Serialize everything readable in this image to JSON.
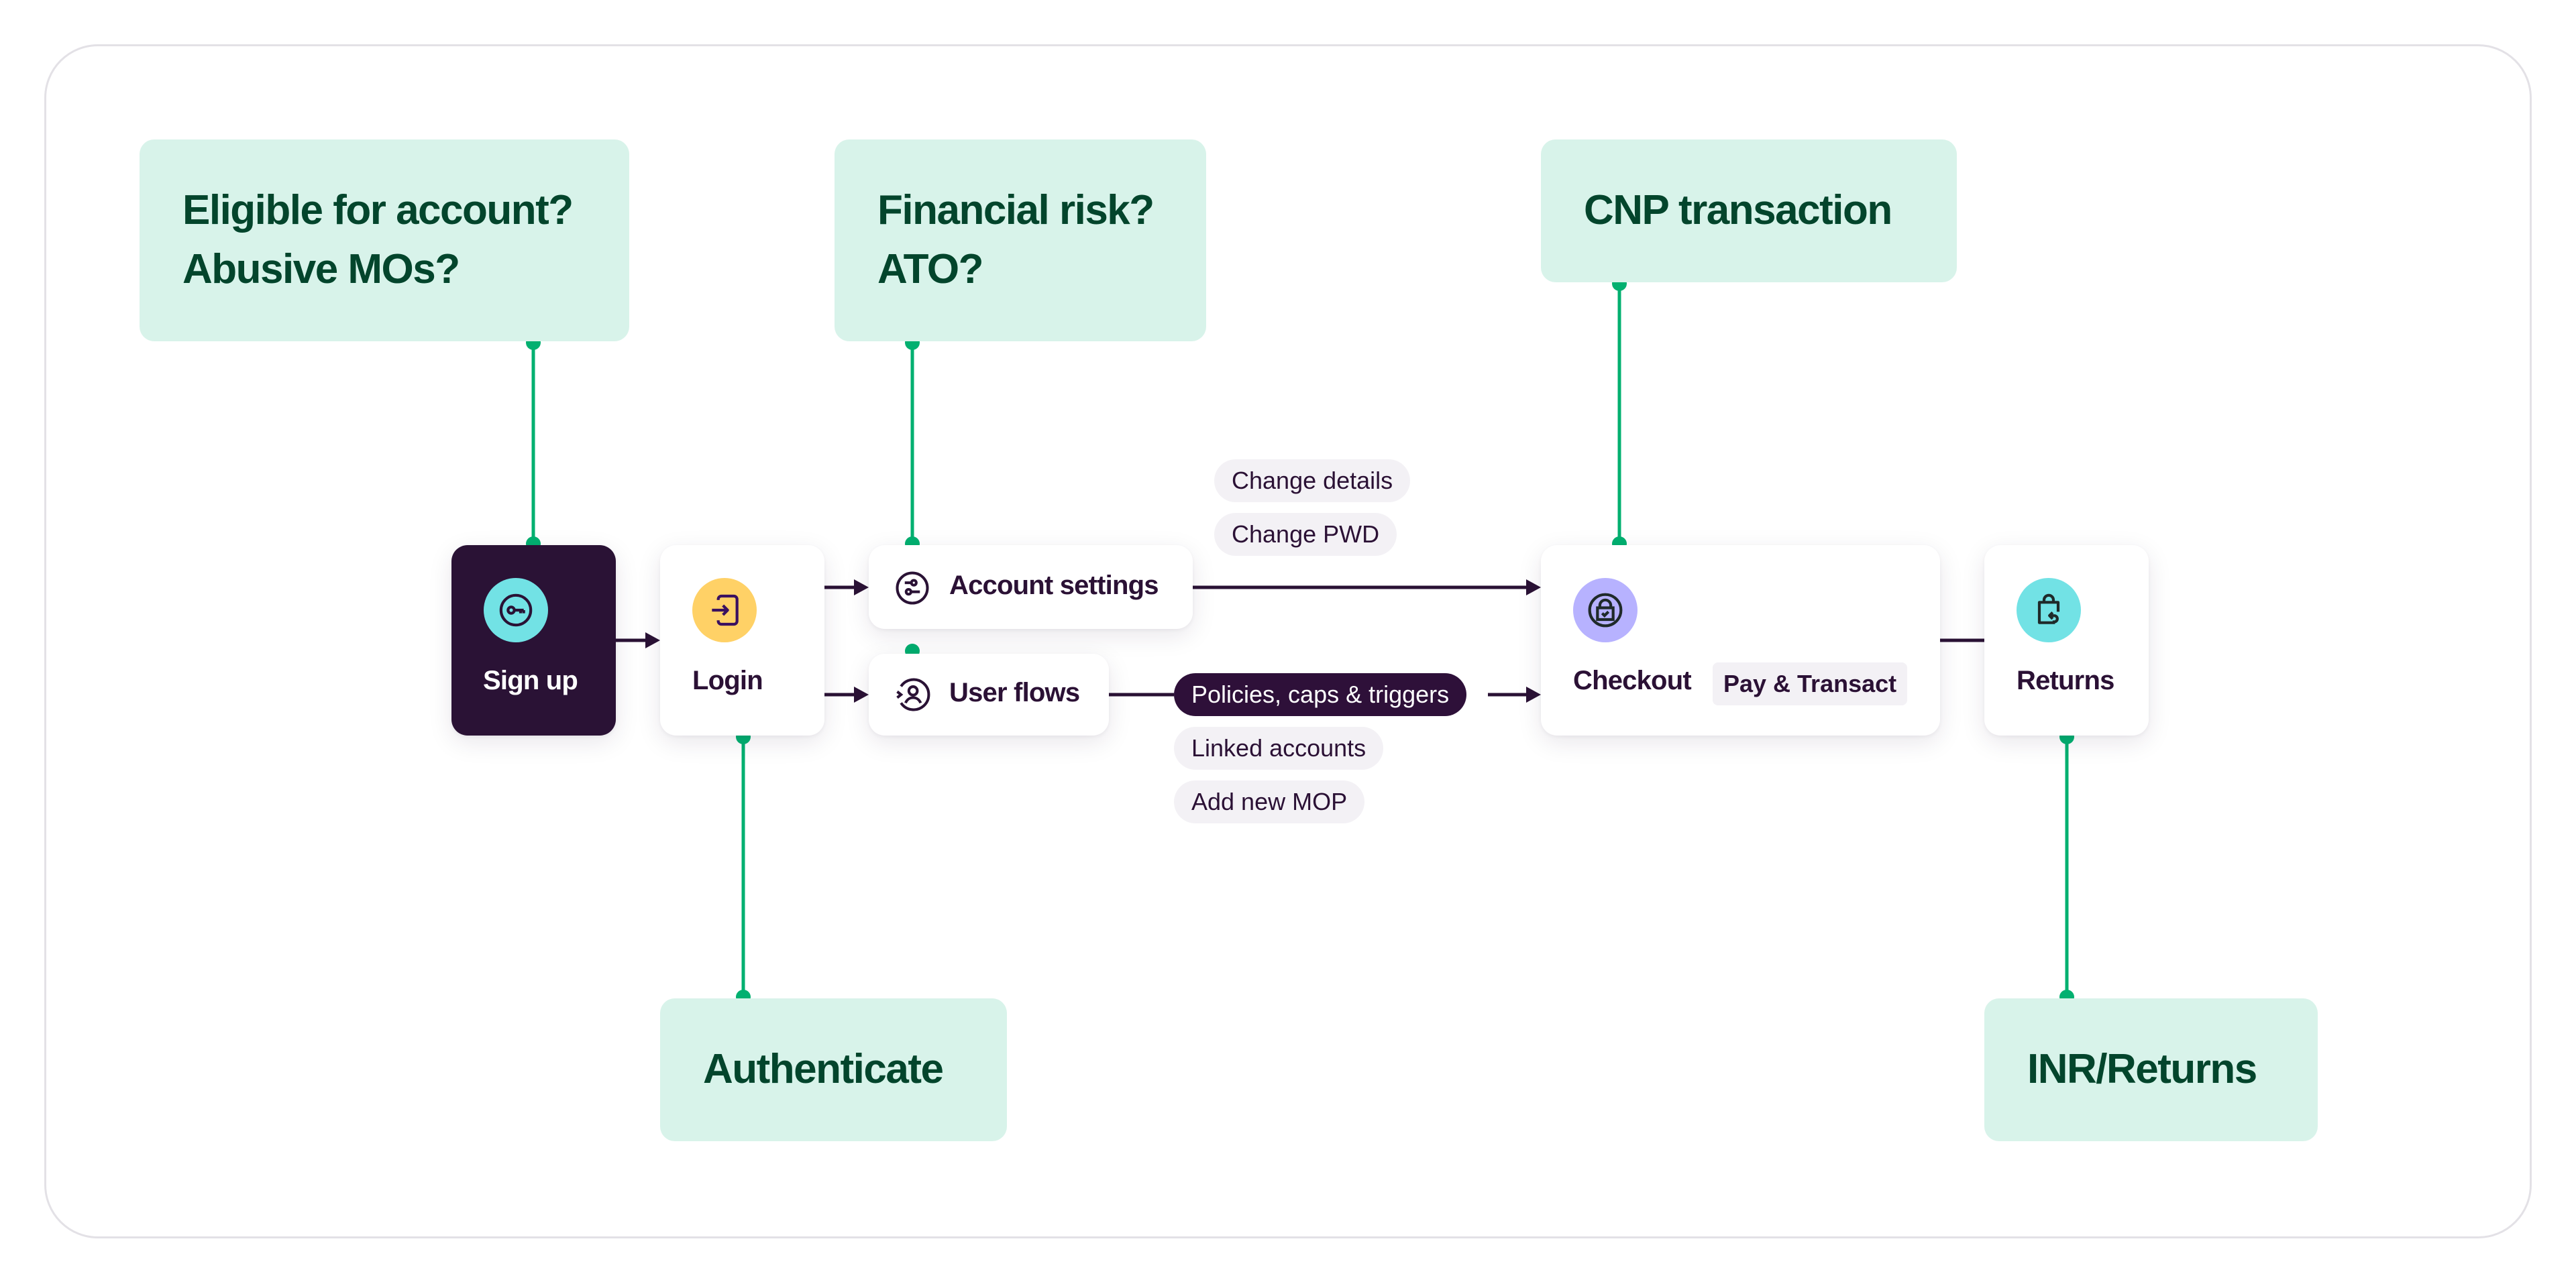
{
  "colors": {
    "callout_bg": "#d8f3ea",
    "callout_text": "#03452c",
    "connector_green": "#02b070",
    "flow_line": "#2a1235",
    "dark_node": "#2a1235",
    "pill_bg": "#f3f1f5",
    "signup_icon_bg": "#72e2e5",
    "login_icon_bg": "#ffd166",
    "checkout_icon_bg": "#b7b2ff",
    "returns_icon_bg": "#72e2e5"
  },
  "callouts": {
    "signup": {
      "lines": [
        "Eligible for account?",
        "Abusive MOs?"
      ]
    },
    "account": {
      "lines": [
        "Financial risk?",
        "ATO?"
      ]
    },
    "checkout": {
      "lines": [
        "CNP transaction"
      ]
    },
    "login": {
      "lines": [
        "Authenticate"
      ]
    },
    "returns": {
      "lines": [
        "INR/Returns"
      ]
    }
  },
  "nodes": {
    "signup": {
      "label": "Sign up",
      "icon": "key-icon"
    },
    "login": {
      "label": "Login",
      "icon": "login-icon"
    },
    "account_settings": {
      "label": "Account settings",
      "icon": "settings-toggle-icon"
    },
    "user_flows": {
      "label": "User flows",
      "icon": "user-flow-icon"
    },
    "checkout": {
      "label": "Checkout",
      "icon": "secure-bag-icon",
      "chip": "Pay & Transact"
    },
    "returns": {
      "label": "Returns",
      "icon": "bag-return-icon"
    }
  },
  "pills": {
    "account_path": [
      "Change details",
      "Change PWD"
    ],
    "user_path_main": "Policies, caps & triggers",
    "user_path_extra": [
      "Linked accounts",
      "Add new MOP"
    ]
  }
}
